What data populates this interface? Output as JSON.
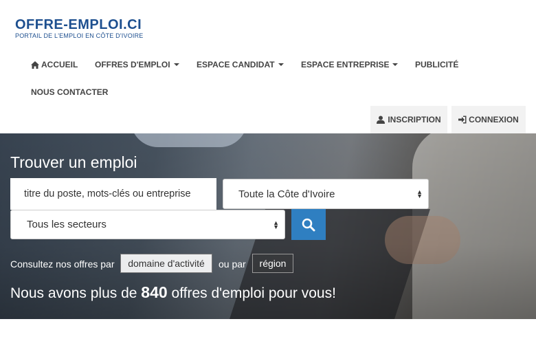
{
  "logo": {
    "line1": "OFFRE-EMPLOI.CI",
    "line2": "PORTAIL DE L'EMPLOI EN CÔTE D'IVOIRE"
  },
  "nav": {
    "accueil": "ACCUEIL",
    "offres": "OFFRES D'EMPLOI",
    "candidat": "ESPACE CANDIDAT",
    "entreprise": "ESPACE ENTREPRISE",
    "publicite": "PUBLICITÉ",
    "contact": "NOUS CONTACTER"
  },
  "auth": {
    "inscription": "INSCRIPTION",
    "connexion": "CONNEXION"
  },
  "hero": {
    "title": "Trouver un emploi",
    "search_placeholder": "titre du poste, mots-clés ou entreprise",
    "region_select": "Toute la Côte d'Ivoire",
    "sector_select": "Tous les secteurs",
    "browse_prefix": "Consultez nos offres par",
    "browse_domain": "domaine d'activité",
    "browse_or": "ou par",
    "browse_region": "région",
    "stats_prefix": "Nous avons plus de",
    "stats_count": "840",
    "stats_suffix": "offres d'emploi pour vous!"
  },
  "colors": {
    "brand": "#1d4f8f",
    "search_button": "#2f7fc1",
    "nav_text": "#444444"
  },
  "icons": {
    "home": "home-icon",
    "user": "user-icon",
    "login": "sign-in-icon",
    "search": "search-icon"
  }
}
